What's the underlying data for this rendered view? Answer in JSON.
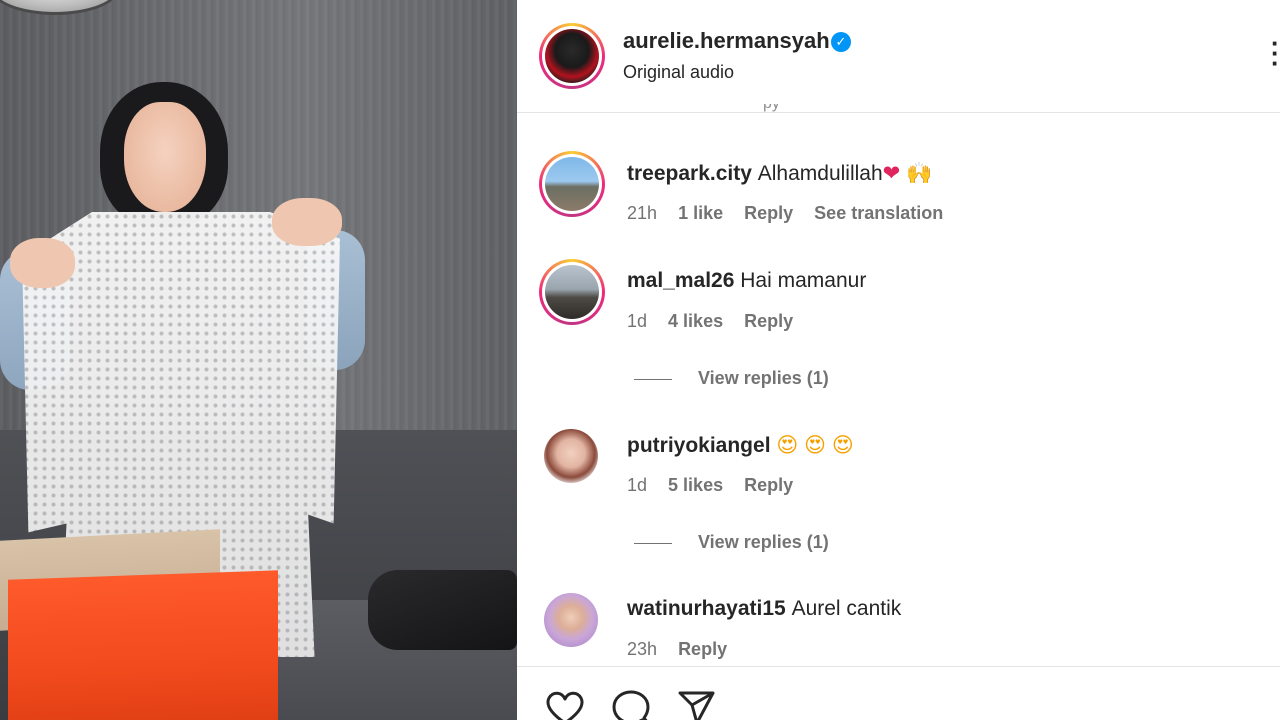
{
  "header": {
    "username": "aurelie.hermansyah",
    "verified_icon": "verified-badge-icon",
    "subtitle": "Original audio",
    "more_icon": "more-options-icon"
  },
  "comments": [
    {
      "username": "treepark.city",
      "text": "Alhamdulillah",
      "emojis": [
        "❤",
        "🙌"
      ],
      "time": "21h",
      "likes": "1 like",
      "reply": "Reply",
      "translate": "See translation"
    },
    {
      "username": "mal_mal26",
      "text": "Hai mamanur",
      "time": "1d",
      "likes": "4 likes",
      "reply": "Reply",
      "view_replies": "View replies (1)"
    },
    {
      "username": "putriyokiangel",
      "emojis": [
        "😍",
        "😍",
        "😍"
      ],
      "time": "1d",
      "likes": "5 likes",
      "reply": "Reply",
      "view_replies": "View replies (1)"
    },
    {
      "username": "watinurhayati15",
      "text": "Aurel cantik",
      "time": "23h",
      "reply": "Reply"
    }
  ],
  "actions": [
    "like-icon",
    "comment-icon",
    "share-icon"
  ],
  "colors": {
    "accent": "#0095f6",
    "story_ring_start": "#f9ce34",
    "story_ring_end": "#ee2a7b",
    "meta_text": "#737373"
  }
}
